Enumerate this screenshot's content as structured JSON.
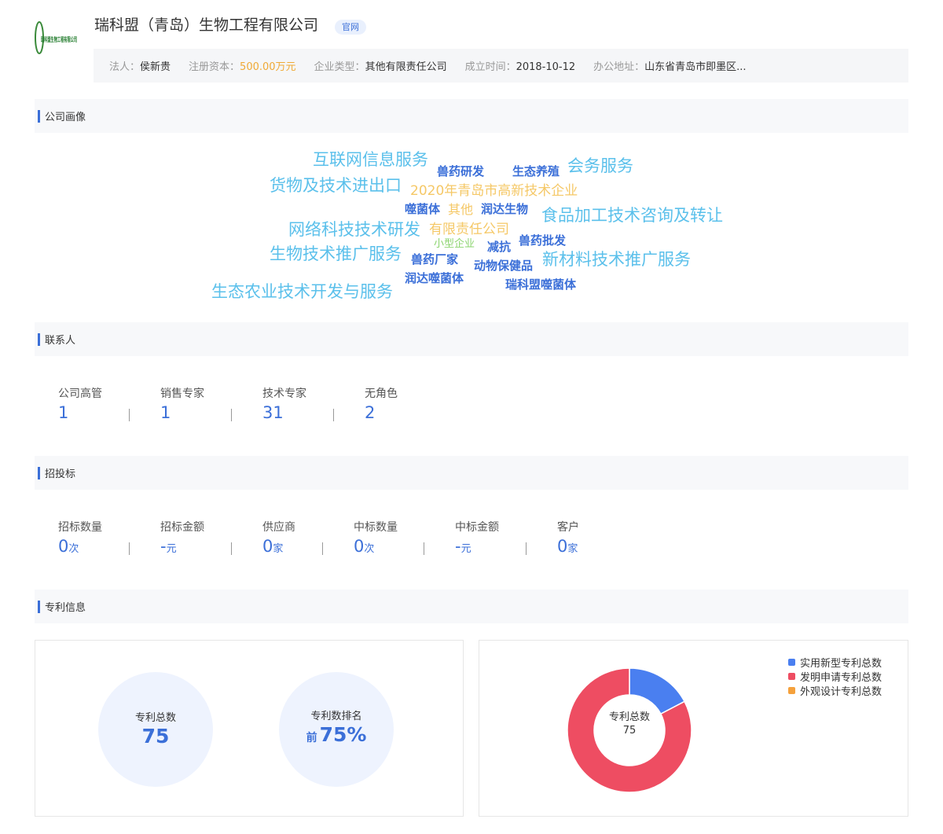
{
  "company": {
    "name": "瑞科盟（青岛）生物工程有限公司",
    "badge": "官网",
    "logo_text": "瑞科盟生物工程有限公司",
    "info": [
      {
        "label": "法人：",
        "value": "侯新贵"
      },
      {
        "label": "注册资本：",
        "value": "500.00万元"
      },
      {
        "label": "企业类型：",
        "value": "其他有限责任公司"
      },
      {
        "label": "成立时间：",
        "value": "2018-10-12"
      },
      {
        "label": "办公地址：",
        "value": "山东省青岛市即墨区..."
      }
    ]
  },
  "sections": {
    "portrait": "公司画像",
    "contacts": "联系人",
    "bidding": "招投标",
    "patents": "专利信息"
  },
  "word_cloud": [
    {
      "text": "互联网信息服务",
      "color": "#5bc0eb"
    },
    {
      "text": "兽药研发",
      "color": "#3b6fd8"
    },
    {
      "text": "生态养殖",
      "color": "#3b6fd8"
    },
    {
      "text": "会务服务",
      "color": "#5bc0eb"
    },
    {
      "text": "货物及技术进出口",
      "color": "#5bc0eb"
    },
    {
      "text": "2020年青岛市高新技术企业",
      "color": "#f5c867"
    },
    {
      "text": "噬菌体",
      "color": "#3b6fd8"
    },
    {
      "text": "其他",
      "color": "#f5c867"
    },
    {
      "text": "润达生物",
      "color": "#3b6fd8"
    },
    {
      "text": "食品加工技术咨询及转让",
      "color": "#5bc0eb"
    },
    {
      "text": "网络科技技术研发",
      "color": "#5bc0eb"
    },
    {
      "text": "有限责任公司",
      "color": "#f5c867"
    },
    {
      "text": "小型企业",
      "color": "#8bd46e"
    },
    {
      "text": "减抗",
      "color": "#3b6fd8"
    },
    {
      "text": "兽药批发",
      "color": "#3b6fd8"
    },
    {
      "text": "生物技术推广服务",
      "color": "#5bc0eb"
    },
    {
      "text": "兽药厂家",
      "color": "#3b6fd8"
    },
    {
      "text": "动物保健品",
      "color": "#3b6fd8"
    },
    {
      "text": "新材料技术推广服务",
      "color": "#5bc0eb"
    },
    {
      "text": "润达噬菌体",
      "color": "#3b6fd8"
    },
    {
      "text": "瑞科盟噬菌体",
      "color": "#3b6fd8"
    },
    {
      "text": "生态农业技术开发与服务",
      "color": "#5bc0eb"
    }
  ],
  "contacts": [
    {
      "label": "公司高管",
      "value": "1"
    },
    {
      "label": "销售专家",
      "value": "1"
    },
    {
      "label": "技术专家",
      "value": "31"
    },
    {
      "label": "无角色",
      "value": "2"
    }
  ],
  "bidding": [
    {
      "label": "招标数量",
      "value": "0",
      "unit": "次"
    },
    {
      "label": "招标金额",
      "value": "-",
      "unit": "元"
    },
    {
      "label": "供应商",
      "value": "0",
      "unit": "家"
    },
    {
      "label": "中标数量",
      "value": "0",
      "unit": "次"
    },
    {
      "label": "中标金额",
      "value": "-",
      "unit": "元"
    },
    {
      "label": "客户",
      "value": "0",
      "unit": "家"
    }
  ],
  "patents": {
    "total_label": "专利总数",
    "total_value": "75",
    "rank_label": "专利数排名",
    "rank_prefix": "前",
    "rank_value": "75%",
    "donut_label": "专利总数",
    "donut_value": "75"
  },
  "chart_data": {
    "type": "pie",
    "series": [
      {
        "name": "实用新型专利总数",
        "value": 13,
        "color": "#4a7ff0"
      },
      {
        "name": "发明申请专利总数",
        "value": 62,
        "color": "#ee4d62"
      },
      {
        "name": "外观设计专利总数",
        "value": 0,
        "color": "#f5a13c"
      }
    ],
    "legend": "top-right"
  }
}
